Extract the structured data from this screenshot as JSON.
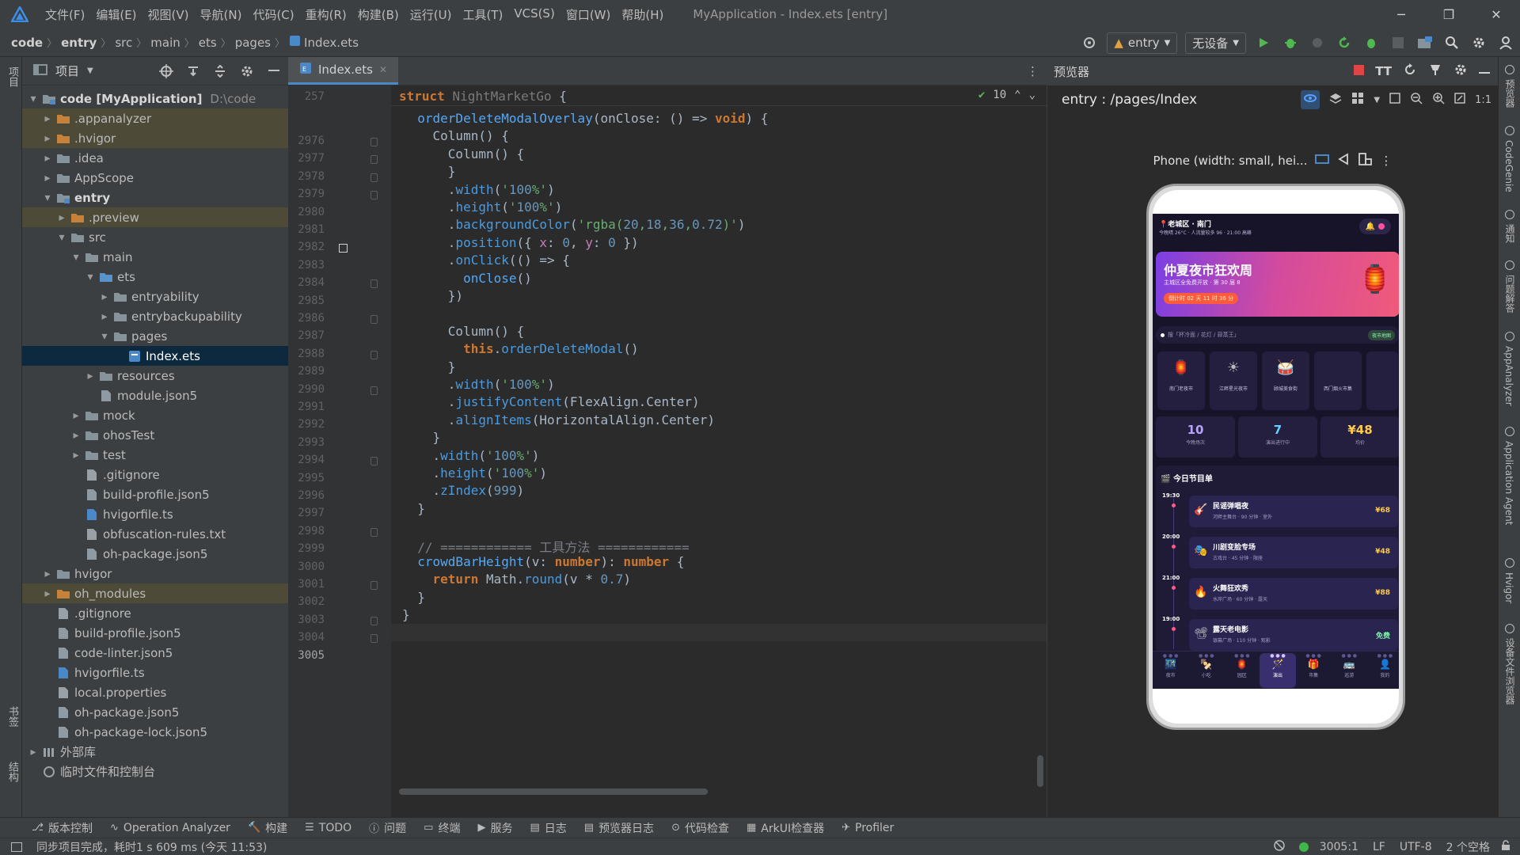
{
  "menu": {
    "items": [
      "文件(F)",
      "编辑(E)",
      "视图(V)",
      "导航(N)",
      "代码(C)",
      "重构(R)",
      "构建(B)",
      "运行(U)",
      "工具(T)",
      "VCS(S)",
      "窗口(W)",
      "帮助(H)"
    ],
    "window_title": "MyApplication - Index.ets [entry]"
  },
  "breadcrumb": [
    "code",
    "entry",
    "src",
    "main",
    "ets",
    "pages",
    "Index.ets"
  ],
  "toolbar": {
    "module": "entry",
    "device": "无设备"
  },
  "left_strip": {
    "project": "项目",
    "bookmarks": "书签",
    "structure": "结构"
  },
  "project_panel": {
    "title": "项目",
    "tree": [
      {
        "label": "code [MyApplication]",
        "extra": "D:\\code",
        "depth": 0,
        "arrow": "down",
        "kind": "module",
        "bold": true
      },
      {
        "label": ".appanalyzer",
        "depth": 1,
        "arrow": "right",
        "kind": "folder-orange",
        "excluded": true
      },
      {
        "label": ".hvigor",
        "depth": 1,
        "arrow": "right",
        "kind": "folder-orange",
        "excluded": true
      },
      {
        "label": ".idea",
        "depth": 1,
        "arrow": "right",
        "kind": "folder"
      },
      {
        "label": "AppScope",
        "depth": 1,
        "arrow": "right",
        "kind": "folder"
      },
      {
        "label": "entry",
        "depth": 1,
        "arrow": "down",
        "kind": "module",
        "bold": true
      },
      {
        "label": ".preview",
        "depth": 2,
        "arrow": "right",
        "kind": "folder-orange",
        "excluded": true
      },
      {
        "label": "src",
        "depth": 2,
        "arrow": "down",
        "kind": "folder"
      },
      {
        "label": "main",
        "depth": 3,
        "arrow": "down",
        "kind": "folder"
      },
      {
        "label": "ets",
        "depth": 4,
        "arrow": "down",
        "kind": "folder-blue"
      },
      {
        "label": "entryability",
        "depth": 5,
        "arrow": "right",
        "kind": "folder"
      },
      {
        "label": "entrybackupability",
        "depth": 5,
        "arrow": "right",
        "kind": "folder"
      },
      {
        "label": "pages",
        "depth": 5,
        "arrow": "down",
        "kind": "folder"
      },
      {
        "label": "Index.ets",
        "depth": 6,
        "arrow": "",
        "kind": "ets",
        "selected": true
      },
      {
        "label": "resources",
        "depth": 4,
        "arrow": "right",
        "kind": "folder"
      },
      {
        "label": "module.json5",
        "depth": 4,
        "arrow": "",
        "kind": "json"
      },
      {
        "label": "mock",
        "depth": 3,
        "arrow": "right",
        "kind": "folder"
      },
      {
        "label": "ohosTest",
        "depth": 3,
        "arrow": "right",
        "kind": "folder"
      },
      {
        "label": "test",
        "depth": 3,
        "arrow": "right",
        "kind": "folder"
      },
      {
        "label": ".gitignore",
        "depth": 3,
        "arrow": "",
        "kind": "file"
      },
      {
        "label": "build-profile.json5",
        "depth": 3,
        "arrow": "",
        "kind": "json"
      },
      {
        "label": "hvigorfile.ts",
        "depth": 3,
        "arrow": "",
        "kind": "ts"
      },
      {
        "label": "obfuscation-rules.txt",
        "depth": 3,
        "arrow": "",
        "kind": "file"
      },
      {
        "label": "oh-package.json5",
        "depth": 3,
        "arrow": "",
        "kind": "json"
      },
      {
        "label": "hvigor",
        "depth": 1,
        "arrow": "right",
        "kind": "folder"
      },
      {
        "label": "oh_modules",
        "depth": 1,
        "arrow": "right",
        "kind": "folder-orange",
        "excluded": true
      },
      {
        "label": ".gitignore",
        "depth": 1,
        "arrow": "",
        "kind": "file"
      },
      {
        "label": "build-profile.json5",
        "depth": 1,
        "arrow": "",
        "kind": "json"
      },
      {
        "label": "code-linter.json5",
        "depth": 1,
        "arrow": "",
        "kind": "json"
      },
      {
        "label": "hvigorfile.ts",
        "depth": 1,
        "arrow": "",
        "kind": "ts"
      },
      {
        "label": "local.properties",
        "depth": 1,
        "arrow": "",
        "kind": "file"
      },
      {
        "label": "oh-package.json5",
        "depth": 1,
        "arrow": "",
        "kind": "json"
      },
      {
        "label": "oh-package-lock.json5",
        "depth": 1,
        "arrow": "",
        "kind": "json"
      },
      {
        "label": "外部库",
        "depth": 0,
        "arrow": "right",
        "kind": "lib"
      },
      {
        "label": "临时文件和控制台",
        "depth": 0,
        "arrow": "",
        "kind": "scratch"
      }
    ]
  },
  "editor": {
    "tab": "Index.ets",
    "sticky_line": "257",
    "sticky_text": "struct NightMarketGo {",
    "inspections": "10",
    "line_numbers": [
      "2976",
      "2977",
      "2978",
      "2979",
      "2980",
      "2981",
      "2982",
      "2983",
      "2984",
      "2985",
      "2986",
      "2987",
      "2988",
      "2989",
      "2990",
      "2991",
      "2992",
      "2993",
      "2994",
      "2995",
      "2996",
      "2997",
      "2998",
      "2999",
      "3000",
      "3001",
      "3002",
      "3003",
      "3004",
      "3005"
    ],
    "code": [
      "  orderDeleteModalOverlay(onClose: () => void) {",
      "    Column() {",
      "      Column() {",
      "      }",
      "      .width('100%')",
      "      .height('100%')",
      "      .backgroundColor('rgba(20,18,36,0.72)')",
      "      .position({ x: 0, y: 0 })",
      "      .onClick(() => {",
      "        onClose()",
      "      })",
      "",
      "      Column() {",
      "        this.orderDeleteModal()",
      "      }",
      "      .width('100%')",
      "      .justifyContent(FlexAlign.Center)",
      "      .alignItems(HorizontalAlign.Center)",
      "    }",
      "    .width('100%')",
      "    .height('100%')",
      "    .zIndex(999)",
      "  }",
      "",
      "  // ============ 工具方法 ============",
      "  crowdBarHeight(v: number): number {",
      "    return Math.round(v * 0.7)",
      "  }",
      "}",
      ""
    ]
  },
  "preview": {
    "title": "预览器",
    "path": "entry : /pages/Index",
    "device": "Phone (width: small, hei...",
    "app": {
      "location": "老城区 · 南门",
      "weather": "今晚晴 26°C · 人流量较多 96 · 21:00 高峰",
      "hero_title": "仲夏夜市狂欢周",
      "hero_sub": "主城区全免费开放 · 第 30 届 8",
      "hero_countdown": "倒计时 02 天 11 时 36 分",
      "search_placeholder": "搜「杯冷面 / 花灯 / 蒜蒸王」",
      "search_btn": "夜市地图",
      "categories": [
        {
          "label": "南门老夜市",
          "icon": "🏮"
        },
        {
          "label": "江畔星光夜市",
          "icon": "☀"
        },
        {
          "label": "顾城美食街",
          "icon": "🥁"
        },
        {
          "label": "西门烟火市集",
          "icon": ""
        }
      ],
      "stats": [
        {
          "value": "10",
          "label": "今晚场次",
          "color": "#b6a3ff"
        },
        {
          "value": "7",
          "label": "演出进行中",
          "color": "#5fd0ff"
        },
        {
          "value": "¥48",
          "label": "均价",
          "color": "#ffcb4a"
        }
      ],
      "program_title": "今日节目单",
      "events": [
        {
          "time": "19:30",
          "name": "民谣弹唱夜",
          "sub": "河畔主舞台 · 90 分钟 · 室外",
          "price": "¥68",
          "icon": "🎸"
        },
        {
          "time": "20:00",
          "name": "川剧变脸专场",
          "sub": "古戏台 · 45 分钟 · 限座",
          "price": "¥48",
          "icon": "🎭"
        },
        {
          "time": "21:00",
          "name": "火舞狂欢秀",
          "sub": "水岸广场 · 60 分钟 · 露天",
          "price": "¥88",
          "icon": "🔥"
        },
        {
          "time": "19:00",
          "name": "露天老电影",
          "sub": "银幕广场 · 110 分钟 · 观影",
          "price": "免费",
          "icon": "📽"
        }
      ],
      "tabs": [
        "夜市",
        "小吃",
        "园区",
        "演出",
        "市集",
        "巡游",
        "我的"
      ],
      "tab_icons": [
        "🌃",
        "🍢",
        "🏮",
        "🪄",
        "🎁",
        "🚌",
        "👤"
      ],
      "active_tab": 3
    }
  },
  "right_strip": [
    "预览器",
    "CodeGenie",
    "通知",
    "问题解答",
    "AppAnalyzer",
    "Application Agent",
    "Hvigor",
    "设备文件浏览器"
  ],
  "bottom_tools": [
    "版本控制",
    "Operation Analyzer",
    "构建",
    "TODO",
    "问题",
    "终端",
    "服务",
    "日志",
    "预览器日志",
    "代码检查",
    "ArkUI检查器",
    "Profiler"
  ],
  "status": {
    "message": "同步项目完成，耗时1 s 609 ms (今天 11:53)",
    "position": "3005:1",
    "line_sep": "LF",
    "encoding": "UTF-8",
    "indent": "2 个空格"
  },
  "colors": {
    "accent": "#4a88c7",
    "selection": "#0d293e",
    "excluded": "#4d4a38",
    "folder": "#87939a",
    "folder_orange": "#c6813a"
  }
}
